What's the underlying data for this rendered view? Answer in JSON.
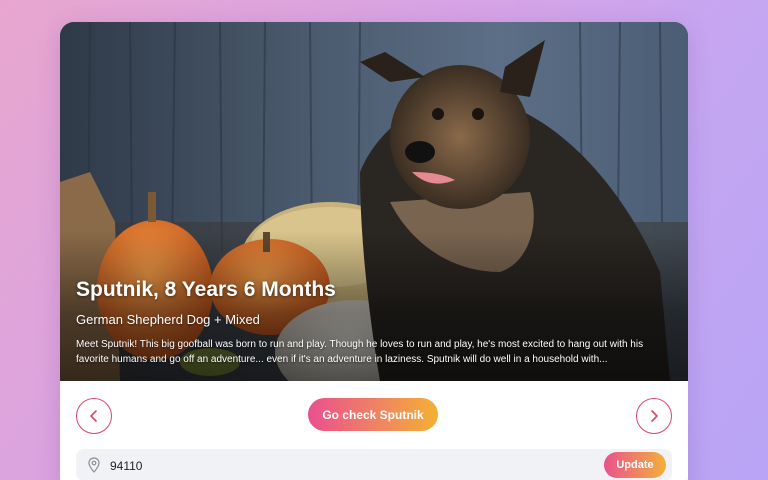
{
  "pet": {
    "title": "Sputnik, 8 Years 6 Months",
    "breed": "German Shepherd Dog + Mixed",
    "description": "Meet Sputnik! This big goofball was born to run and play. Though he loves to run and play, he's most excited to hang out with his favorite humans and go off an adventure... even if it's an adventure in laziness. Sputnik will do well in a household with..."
  },
  "actions": {
    "cta_label": "Go check Sputnik",
    "prev_icon": "chevron-left-icon",
    "next_icon": "chevron-right-icon"
  },
  "location": {
    "icon": "map-pin-icon",
    "zip_value": "94110",
    "update_label": "Update"
  },
  "colors": {
    "accent_pink": "#e9528e",
    "accent_orange": "#f3b133",
    "nav_border": "#d9476b"
  }
}
